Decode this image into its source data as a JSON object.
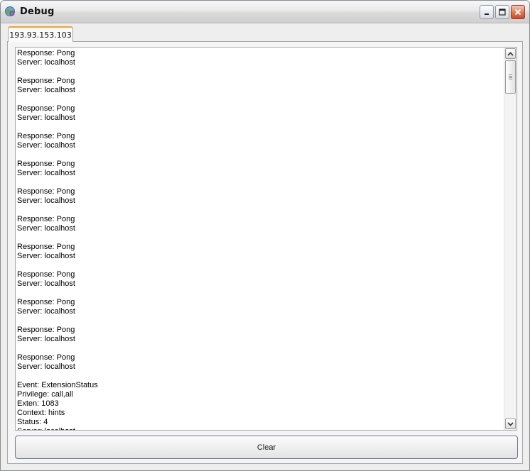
{
  "window": {
    "title": "Debug"
  },
  "tabs": [
    {
      "label": "193.93.153.103",
      "active": true
    }
  ],
  "log": {
    "lines": [
      "Response: Pong",
      "Server: localhost",
      "",
      "Response: Pong",
      "Server: localhost",
      "",
      "Response: Pong",
      "Server: localhost",
      "",
      "Response: Pong",
      "Server: localhost",
      "",
      "Response: Pong",
      "Server: localhost",
      "",
      "Response: Pong",
      "Server: localhost",
      "",
      "Response: Pong",
      "Server: localhost",
      "",
      "Response: Pong",
      "Server: localhost",
      "",
      "Response: Pong",
      "Server: localhost",
      "",
      "Response: Pong",
      "Server: localhost",
      "",
      "Response: Pong",
      "Server: localhost",
      "",
      "Response: Pong",
      "Server: localhost",
      "",
      "Event: ExtensionStatus",
      "Privilege: call,all",
      "Exten: 1083",
      "Context: hints",
      "Status: 4",
      "Server: localhost"
    ]
  },
  "buttons": {
    "clear_label": "Clear"
  },
  "colors": {
    "tab_accent": "#f0a430",
    "close_button": "#e27d5b"
  }
}
